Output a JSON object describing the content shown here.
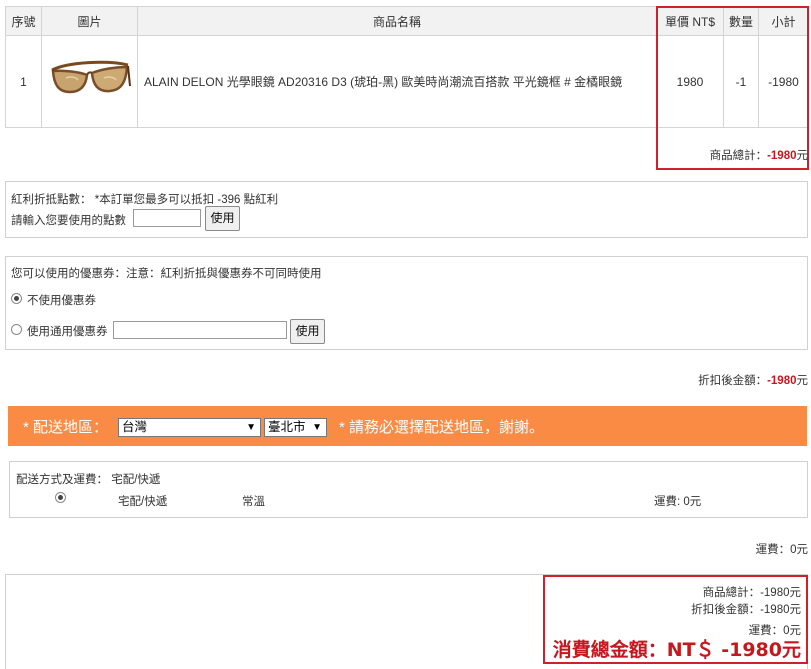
{
  "cart": {
    "headers": {
      "no": "序號",
      "image": "圖片",
      "name": "商品名稱",
      "price": "單價 NT$",
      "qty": "數量",
      "subtotal": "小計"
    },
    "row": {
      "no": "1",
      "name": "ALAIN DELON 光學眼鏡 AD20316 D3 (琥珀-黑) 歐美時尚潮流百搭款 平光鏡框 # 金橘眼鏡",
      "price": "1980",
      "qty": "-1",
      "subtotal": "-1980"
    },
    "total_label": "商品總計：",
    "total_value": "-1980",
    "total_unit": "元"
  },
  "bonus": {
    "info": "紅利折抵點數： *本訂單您最多可以抵扣 -396 點紅利",
    "prompt": "請輸入您要使用的點數",
    "use_button": "使用",
    "input_value": ""
  },
  "coupon": {
    "info": "您可以使用的優惠券：注意：紅利折抵與優惠券不可同時使用",
    "option_none": "不使用優惠券",
    "option_general": "使用通用優惠券",
    "use_button": "使用",
    "input_value": ""
  },
  "discount": {
    "label": "折扣後金額：",
    "value": "-1980",
    "unit": "元"
  },
  "delivery_region": {
    "label": "* 配送地區：",
    "country": "台灣",
    "city": "臺北市",
    "notice": "* 請務必選擇配送地區，謝謝。"
  },
  "shipping": {
    "title": "配送方式及運費： 宅配/快遞",
    "method": "宅配/快遞",
    "temperature": "常溫",
    "fee_text": "運費: 0元",
    "summary": "運費：0元"
  },
  "summary": {
    "items_total": "商品總計：-1980元",
    "after_discount": "折扣後金額：-1980元",
    "shipping": "運費：0元",
    "grand_total": "消費總金額：NT＄ -1980元"
  },
  "colors": {
    "accent_red": "#d0202a",
    "orange_bar": "#f98b45"
  },
  "icons": {
    "product_image": "glasses-icon",
    "dropdown": "triangle-down-icon"
  }
}
